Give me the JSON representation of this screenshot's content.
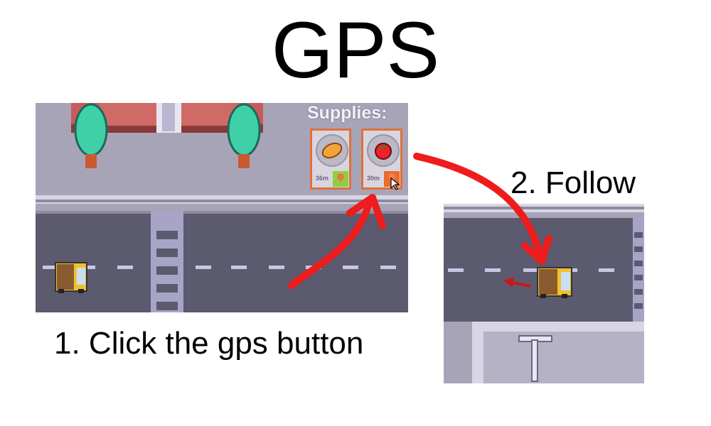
{
  "title": "GPS",
  "steps": {
    "step1": "1. Click the gps button",
    "step2": "2. Follow"
  },
  "hud": {
    "supplies_label": "Supplies:",
    "items": [
      {
        "name": "sweet-potato",
        "distance": "36m",
        "gps_state": "idle",
        "gps_color": "#8fcf3e"
      },
      {
        "name": "tomato",
        "distance": "30m",
        "gps_state": "selected",
        "gps_color": "#ec6a2a"
      }
    ]
  },
  "colors": {
    "annotation_arrow": "#ee1c1c",
    "card_border": "#e0703a",
    "road": "#5c5a6e",
    "sidewalk": "#a8a4b8",
    "direction_arrow": "#c41a1a"
  },
  "icons": [
    "map-pin-icon",
    "mouse-cursor-icon",
    "delivery-truck-icon",
    "street-lamp-icon"
  ]
}
